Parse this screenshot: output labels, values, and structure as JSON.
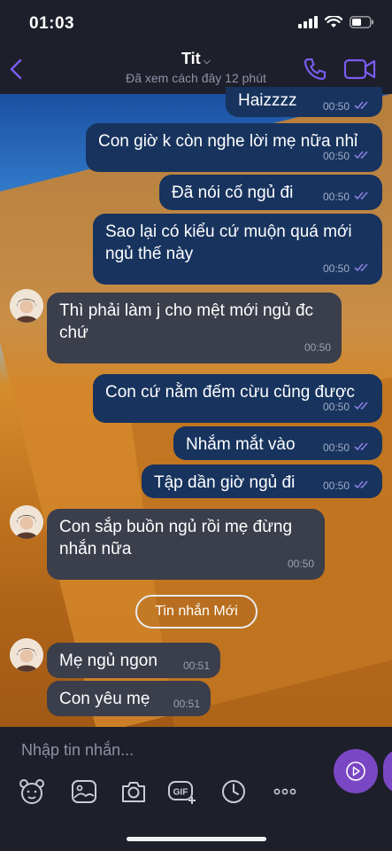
{
  "status": {
    "time": "01:03"
  },
  "header": {
    "title": "Tit",
    "subtitle": "Đã xem cách đây 12 phút"
  },
  "messages": [
    {
      "dir": "out",
      "text": "Haizzzz",
      "time": "00:50"
    },
    {
      "dir": "out",
      "text": "Con giờ k còn nghe lời mẹ nữa nhỉ",
      "time": "00:50"
    },
    {
      "dir": "out",
      "text": "Đã nói cố ngủ đi",
      "time": "00:50"
    },
    {
      "dir": "out",
      "text": "Sao lại có kiểu cứ muộn quá mới ngủ thế này",
      "time": "00:50"
    },
    {
      "dir": "in",
      "text": "Thì phải làm j cho mệt mới ngủ đc chứ",
      "time": "00:50"
    },
    {
      "dir": "out",
      "text": "Con cứ nằm đếm cừu cũng được",
      "time": "00:50"
    },
    {
      "dir": "out",
      "text": "Nhắm mắt vào",
      "time": "00:50"
    },
    {
      "dir": "out",
      "text": "Tập dần giờ ngủ đi",
      "time": "00:50"
    },
    {
      "dir": "in",
      "text": "Con sắp buồn ngủ rồi mẹ đừng nhắn nữa",
      "time": "00:50"
    },
    {
      "dir": "in",
      "text": "Mẹ ngủ ngon",
      "time": "00:51"
    },
    {
      "dir": "in",
      "text": "Con yêu mẹ",
      "time": "00:51"
    }
  ],
  "new_messages_label": "Tin nhắn Mới",
  "composer": {
    "placeholder": "Nhập tin nhắn...",
    "toolbar_icons": [
      "sticker-icon",
      "gallery-icon",
      "camera-icon",
      "gif-icon",
      "clock-icon",
      "more-icon"
    ]
  },
  "colors": {
    "accent": "#7a47c4",
    "outgoing_bubble": "#17335e",
    "incoming_bubble": "#3b3e4b",
    "seen_check": "#8b7fe0"
  }
}
